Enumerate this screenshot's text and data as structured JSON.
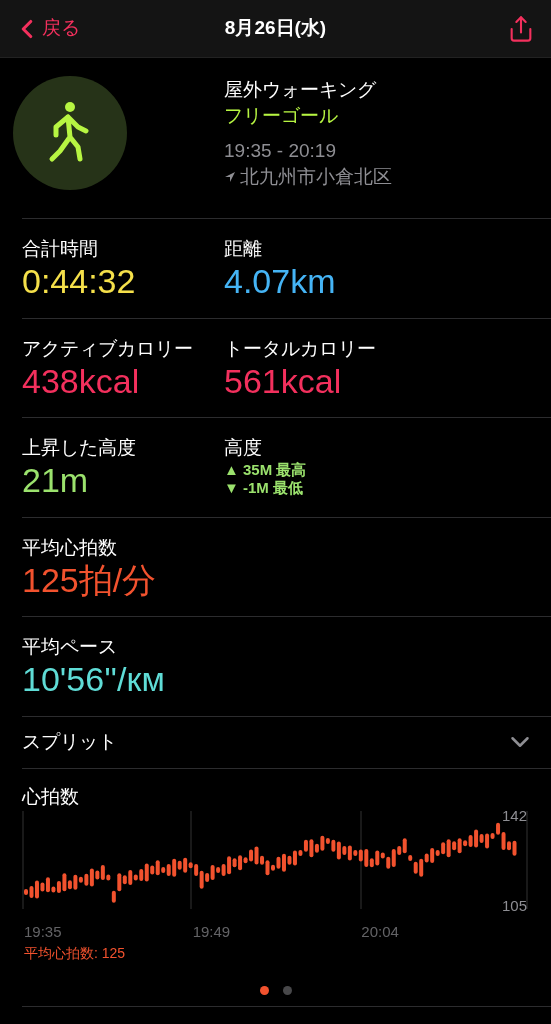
{
  "nav": {
    "back": "戻る",
    "title": "8月26日(水)"
  },
  "workout": {
    "name": "屋外ウォーキング",
    "goal": "フリーゴール",
    "time": "19:35 - 20:19",
    "location": "北九州市小倉北区"
  },
  "metrics": [
    {
      "kind": "pair",
      "items": [
        {
          "label": "合計時間",
          "value": "0:44:32",
          "color": "#f5e04a"
        },
        {
          "label": "距離",
          "value": "4.07km",
          "color": "#45b4f5"
        }
      ]
    },
    {
      "kind": "pair",
      "items": [
        {
          "label": "アクティブカロリー",
          "value": "438kcal",
          "color": "#f3305d"
        },
        {
          "label": "トータルカロリー",
          "value": "561kcal",
          "color": "#f3305d"
        }
      ]
    },
    {
      "kind": "elevation",
      "items": [
        {
          "label": "上昇した高度",
          "value": "21m",
          "color": "#9be26d"
        }
      ],
      "range": {
        "label": "高度",
        "high": "▲ 35M 最高",
        "low": "▼ -1M 最低"
      }
    },
    {
      "kind": "single",
      "items": [
        {
          "label": "平均心拍数",
          "value": "125拍/分",
          "color": "#f2522e"
        }
      ]
    },
    {
      "kind": "single",
      "items": [
        {
          "label": "平均ペース",
          "value": "10'56''/км",
          "color": "#5fdcd6"
        }
      ]
    }
  ],
  "splits": {
    "label": "スプリット",
    "expanded": false
  },
  "heart_rate": {
    "title": "心拍数",
    "max": "142",
    "min": "105",
    "times": [
      "19:35",
      "19:49",
      "20:04"
    ],
    "average": "平均心拍数: 125"
  },
  "pages": [
    {
      "selected": true
    },
    {
      "selected": false
    }
  ]
}
